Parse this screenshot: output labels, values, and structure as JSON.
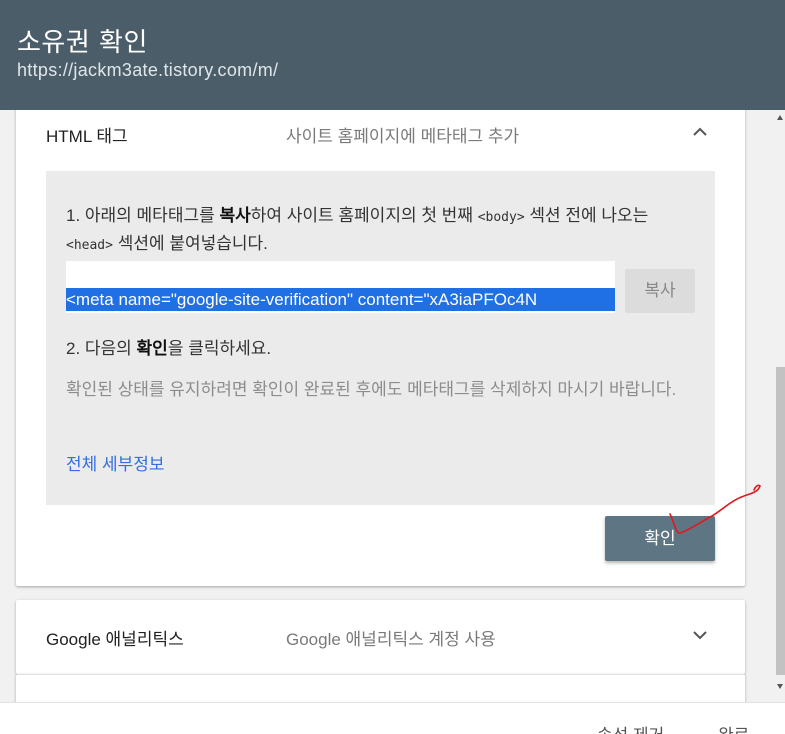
{
  "header": {
    "title": "소유권 확인",
    "url": "https://jackm3ate.tistory.com/m/"
  },
  "html_tag": {
    "name": "HTML 태그",
    "description": "사이트 홈페이지에 메타태그 추가",
    "step1_prefix": "1. 아래의 메타태그를 ",
    "step1_bold": "복사",
    "step1_mid": "하여 사이트 홈페이지의 첫 번째 ",
    "step1_body_tag": "<body>",
    "step1_mid2": " 섹션 전에 나오는 ",
    "step1_head_tag": "<head>",
    "step1_suffix": " 섹션에 붙여넣습니다.",
    "meta_tag": "<meta name=\"google-site-verification\" content=\"xA3iaPFOc4N",
    "copy_label": "복사",
    "step2_prefix": "2. 다음의 ",
    "step2_bold": "확인",
    "step2_suffix": "을 클릭하세요.",
    "note": "확인된 상태를 유지하려면 확인이 완료된 후에도 메타태그를 삭제하지 마시기 바랍니다.",
    "details_link": "전체 세부정보",
    "verify_label": "확인"
  },
  "google_analytics": {
    "name": "Google 애널리틱스",
    "description": "Google 애널리틱스 계정 사용"
  },
  "footer": {
    "remove_label": "속성 제거",
    "done_label": "완료"
  },
  "colors": {
    "header_bg": "#4b5d69",
    "link": "#2f6fe0",
    "selection": "#1f6fe5",
    "verify_button": "#5e7683",
    "annotation": "#e0191f"
  }
}
